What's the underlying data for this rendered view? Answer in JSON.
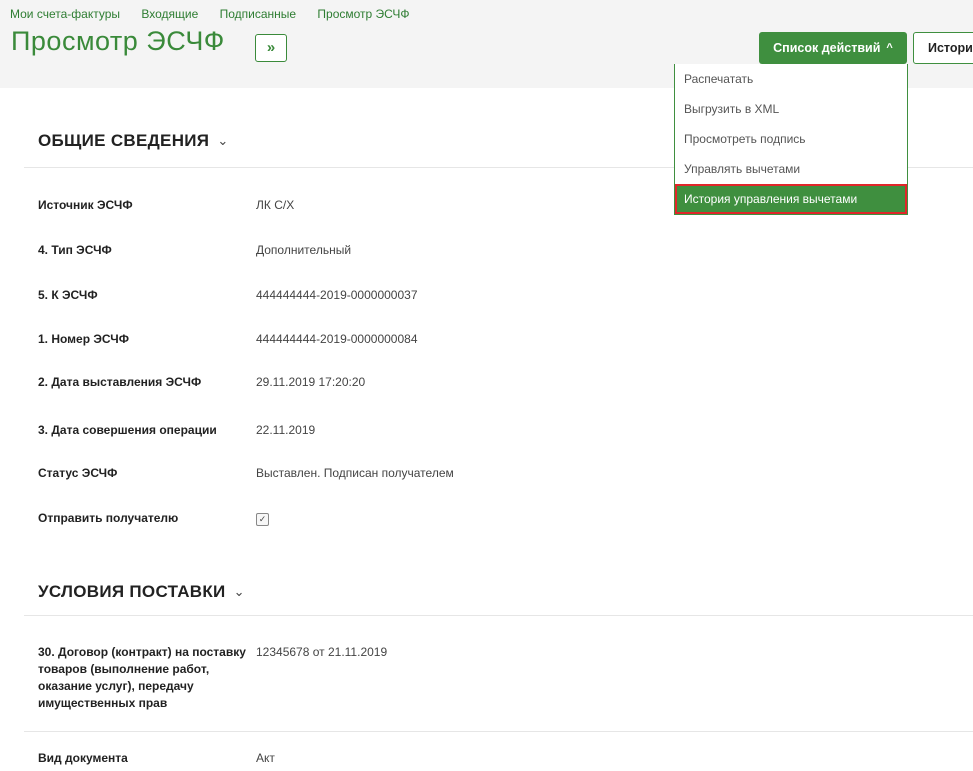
{
  "breadcrumb": [
    "Мои счета-фактуры",
    "Входящие",
    "Подписанные",
    "Просмотр ЭСЧФ"
  ],
  "page_title": "Просмотр ЭСЧФ",
  "expand_label": "»",
  "actions": {
    "label": "Список действий",
    "chevron": "^",
    "menu": [
      "Распечатать",
      "Выгрузить в XML",
      "Просмотреть подпись",
      "Управлять вычетами",
      "История управления вычетами"
    ]
  },
  "history_button": "История",
  "sections": {
    "general": {
      "title": "ОБЩИЕ СВЕДЕНИЯ",
      "chevron": "⌄",
      "rows": [
        {
          "label": "Источник ЭСЧФ",
          "value": "ЛК С/Х"
        },
        {
          "label": "4. Тип ЭСЧФ",
          "value": "Дополнительный"
        },
        {
          "label": "5. К ЭСЧФ",
          "value": "444444444-2019-0000000037"
        },
        {
          "label": "1. Номер ЭСЧФ",
          "value": "444444444-2019-0000000084"
        },
        {
          "label": "2. Дата выставления ЭСЧФ",
          "value": "29.11.2019 17:20:20"
        },
        {
          "label": "3. Дата совершения операции",
          "value": "22.11.2019"
        },
        {
          "label": "Статус ЭСЧФ",
          "value": "Выставлен. Подписан получателем"
        },
        {
          "label": "Отправить получателю",
          "value": "✓"
        }
      ]
    },
    "delivery": {
      "title": "УСЛОВИЯ ПОСТАВКИ",
      "chevron": "⌄",
      "rows": [
        {
          "label": "30. Договор (контракт) на поставку товаров (выполнение работ, оказание услуг), передачу имущественных прав",
          "value": "12345678 от 21.11.2019"
        },
        {
          "label": "Вид документа",
          "value": "Акт"
        }
      ]
    }
  }
}
